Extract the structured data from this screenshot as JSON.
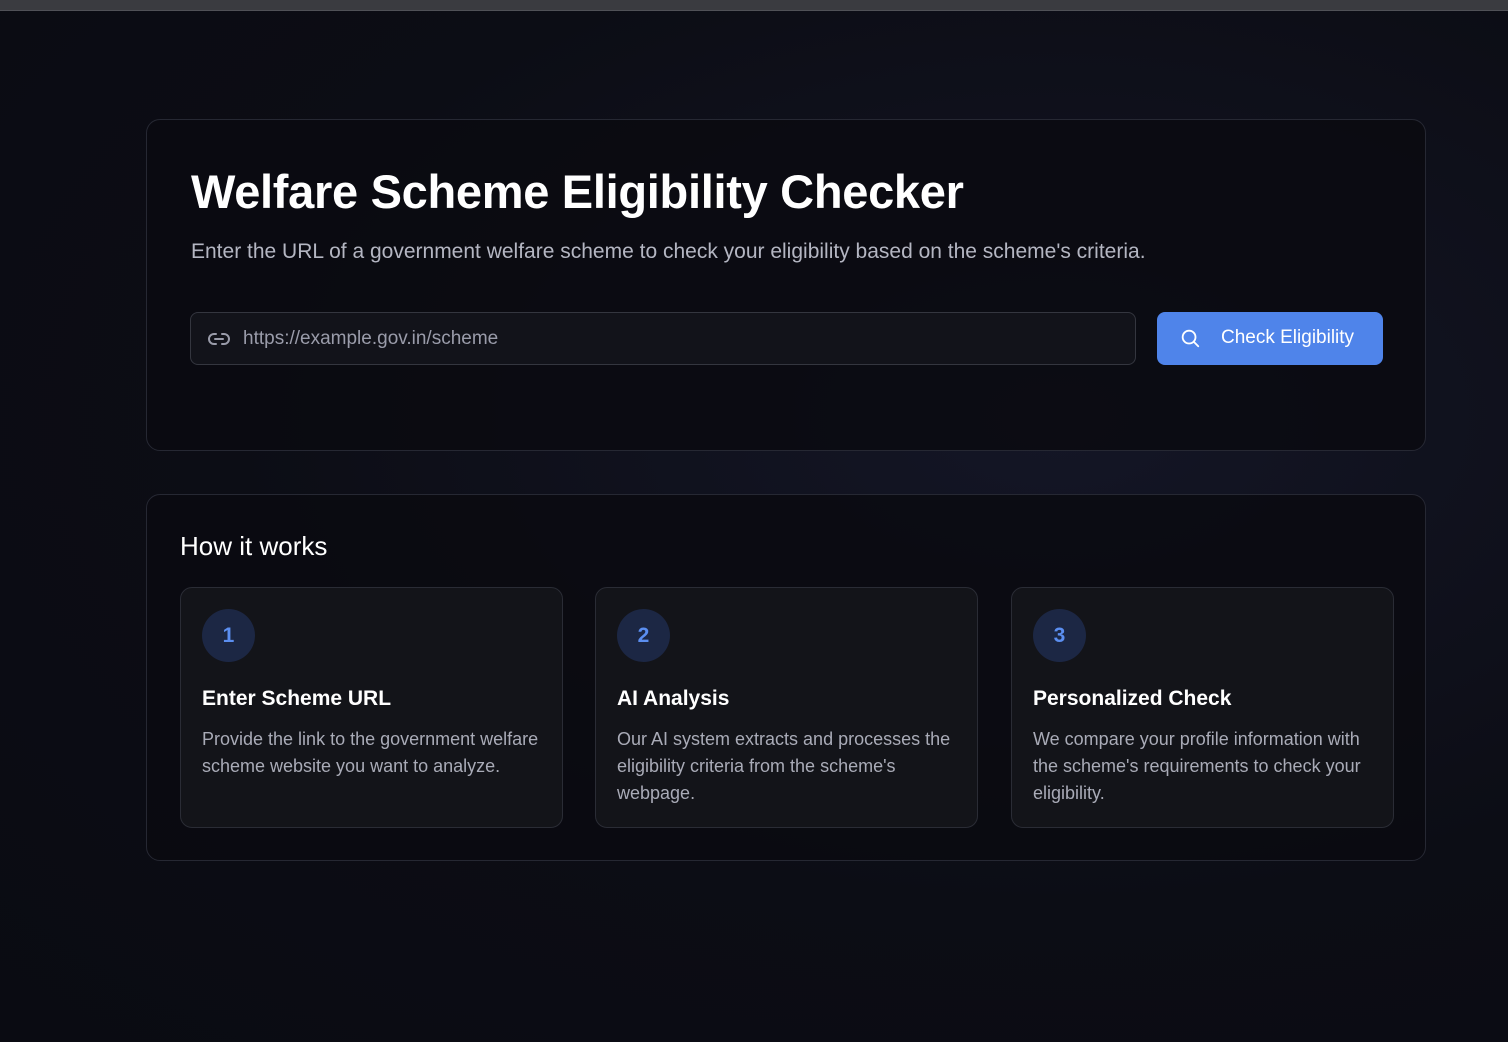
{
  "hero": {
    "title": "Welfare Scheme Eligibility Checker",
    "subtitle": "Enter the URL of a government welfare scheme to check your eligibility based on the scheme's criteria.",
    "url_input": {
      "value": "",
      "placeholder": "https://example.gov.in/scheme",
      "icon": "link-icon"
    },
    "check_button": {
      "label": "Check Eligibility",
      "icon": "search-icon"
    }
  },
  "how_it_works": {
    "title": "How it works",
    "steps": [
      {
        "number": "1",
        "title": "Enter Scheme URL",
        "description": "Provide the link to the government welfare scheme website you want to analyze."
      },
      {
        "number": "2",
        "title": "AI Analysis",
        "description": "Our AI system extracts and processes the eligibility criteria from the scheme's webpage."
      },
      {
        "number": "3",
        "title": "Personalized Check",
        "description": "We compare your profile information with the scheme's requirements to check your eligibility."
      }
    ]
  },
  "colors": {
    "accent": "#4f84ea",
    "step_number_bg": "#1c2744",
    "step_number_text": "#5b8ef0",
    "background": "#0b0c12"
  }
}
